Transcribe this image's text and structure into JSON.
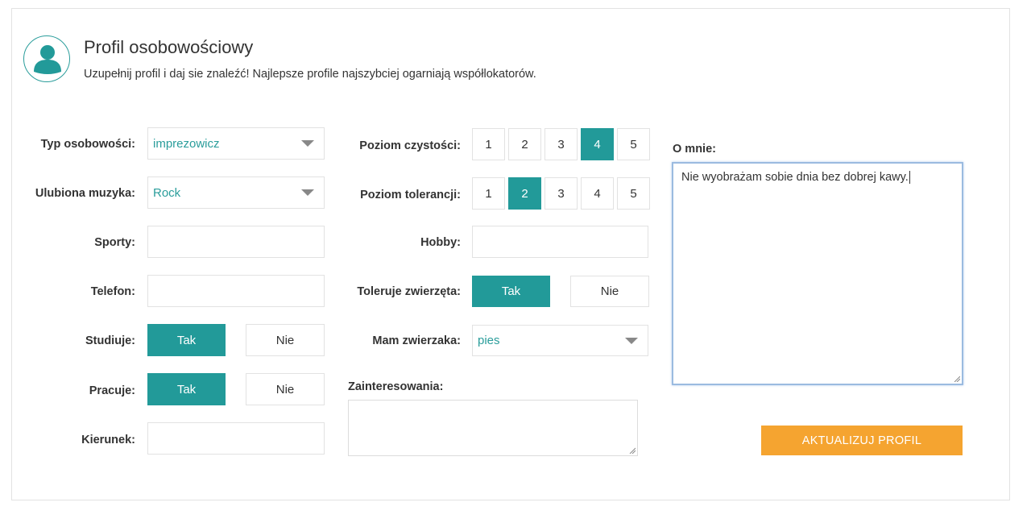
{
  "header": {
    "title": "Profil osobowościowy",
    "subtitle": "Uzupełnij profil i daj sie znaleźć! Najlepsze profile najszybciej ogarniają współlokatorów."
  },
  "colors": {
    "accent": "#229a99",
    "button": "#f5a430",
    "select_text": "#2a9d9b"
  },
  "left": {
    "personality": {
      "label": "Typ osobowości:",
      "value": "imprezowicz"
    },
    "music": {
      "label": "Ulubiona muzyka:",
      "value": "Rock"
    },
    "sports": {
      "label": "Sporty:",
      "value": ""
    },
    "phone": {
      "label": "Telefon:",
      "value": ""
    },
    "studies": {
      "label": "Studiuje:",
      "yes": "Tak",
      "no": "Nie",
      "selected": "Tak"
    },
    "works": {
      "label": "Pracuje:",
      "yes": "Tak",
      "no": "Nie",
      "selected": "Tak"
    },
    "major": {
      "label": "Kierunek:",
      "value": ""
    }
  },
  "middle": {
    "cleanliness": {
      "label": "Poziom czystości:",
      "options": [
        "1",
        "2",
        "3",
        "4",
        "5"
      ],
      "selected": "4"
    },
    "tolerance": {
      "label": "Poziom tolerancji:",
      "options": [
        "1",
        "2",
        "3",
        "4",
        "5"
      ],
      "selected": "2"
    },
    "hobby": {
      "label": "Hobby:",
      "value": ""
    },
    "pets_tolerance": {
      "label": "Toleruje zwierzęta:",
      "yes": "Tak",
      "no": "Nie",
      "selected": "Tak"
    },
    "pet": {
      "label": "Mam zwierzaka:",
      "value": "pies"
    },
    "interests": {
      "label": "Zainteresowania:",
      "value": ""
    }
  },
  "right": {
    "about": {
      "label": "O mnie:",
      "value": "Nie wyobrażam sobie dnia bez dobrej kawy."
    },
    "update_button": "AKTUALIZUJ PROFIL"
  }
}
